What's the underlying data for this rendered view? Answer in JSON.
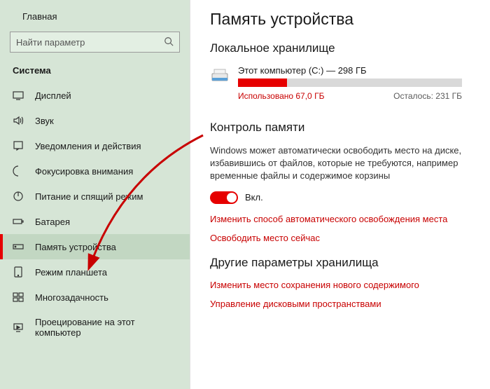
{
  "sidebar": {
    "home": "Главная",
    "search_placeholder": "Найти параметр",
    "section": "Система",
    "items": [
      {
        "icon": "display",
        "label": "Дисплей"
      },
      {
        "icon": "sound",
        "label": "Звук"
      },
      {
        "icon": "notify",
        "label": "Уведомления и действия"
      },
      {
        "icon": "focus",
        "label": "Фокусировка внимания"
      },
      {
        "icon": "power",
        "label": "Питание и спящий режим"
      },
      {
        "icon": "battery",
        "label": "Батарея"
      },
      {
        "icon": "storage",
        "label": "Память устройства",
        "active": true
      },
      {
        "icon": "tablet",
        "label": "Режим планшета"
      },
      {
        "icon": "multitask",
        "label": "Многозадачность"
      },
      {
        "icon": "project",
        "label": "Проецирование на этот компьютер"
      }
    ]
  },
  "page": {
    "title": "Память устройства",
    "local_storage_heading": "Локальное хранилище",
    "drive": {
      "name": "Этот компьютер (C:) — 298 ГБ",
      "used_label": "Использовано 67,0 ГБ",
      "remain_label": "Осталось: 231 ГБ",
      "used_percent": 22
    },
    "storage_sense": {
      "heading": "Контроль памяти",
      "description": "Windows может автоматически освободить место на диске, избавившись от файлов, которые не требуются, например временные файлы и содержимое корзины",
      "toggle_label": "Вкл.",
      "link_change": "Изменить способ автоматического освобождения места",
      "link_free_now": "Освободить место сейчас"
    },
    "other": {
      "heading": "Другие параметры хранилища",
      "link_change_location": "Изменить место сохранения нового содержимого",
      "link_manage_spaces": "Управление дисковыми пространствами"
    }
  }
}
